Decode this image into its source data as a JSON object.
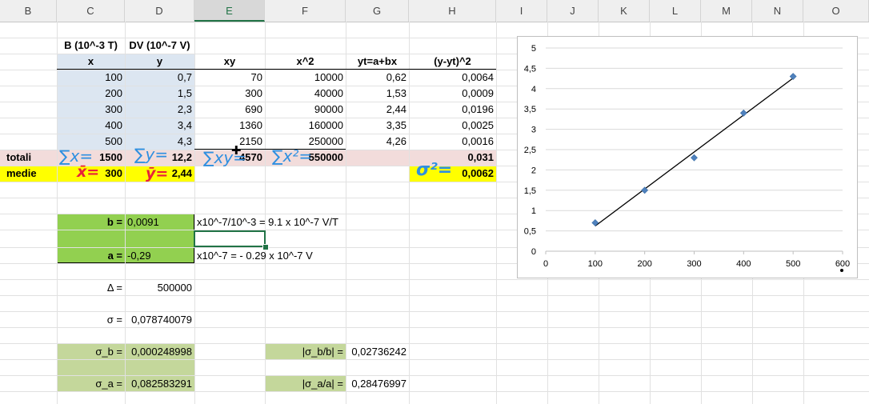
{
  "columns": [
    "B",
    "C",
    "D",
    "E",
    "F",
    "G",
    "H",
    "I",
    "J",
    "K",
    "L",
    "M",
    "N",
    "O"
  ],
  "headers": {
    "B_label": "B (10^-3 T)",
    "DV_label": "DV (10^-7 V)",
    "x": "x",
    "y": "y",
    "xy": "xy",
    "x2": "x^2",
    "yt": "yt=a+bx",
    "res": "(y-yt)^2"
  },
  "rows": [
    {
      "x": "100",
      "y": "0,7",
      "xy": "70",
      "x2": "10000",
      "yt": "0,62",
      "res": "0,0064"
    },
    {
      "x": "200",
      "y": "1,5",
      "xy": "300",
      "x2": "40000",
      "yt": "1,53",
      "res": "0,0009"
    },
    {
      "x": "300",
      "y": "2,3",
      "xy": "690",
      "x2": "90000",
      "yt": "2,44",
      "res": "0,0196"
    },
    {
      "x": "400",
      "y": "3,4",
      "xy": "1360",
      "x2": "160000",
      "yt": "3,35",
      "res": "0,0025"
    },
    {
      "x": "500",
      "y": "4,3",
      "xy": "2150",
      "x2": "250000",
      "yt": "4,26",
      "res": "0,0016"
    }
  ],
  "totali": {
    "label": "totali",
    "x": "1500",
    "y": "12,2",
    "xy": "4570",
    "x2": "550000",
    "res": "0,031"
  },
  "medie": {
    "label": "medie",
    "x": "300",
    "y": "2,44",
    "res": "0,0062"
  },
  "fit": {
    "b_label": "b =",
    "b_value": "0,0091",
    "b_note": "x10^-7/10^-3 = 9.1 x 10^-7 V/T",
    "a_label": "a =",
    "a_value": "-0,29",
    "a_note": "x10^-7 = - 0.29 x 10^-7 V"
  },
  "stats": {
    "delta_label": "Δ =",
    "delta_value": "500000",
    "sigma_label": "σ =",
    "sigma_value": "0,078740079",
    "sigma_b_label": "σ_b =",
    "sigma_b_value": "0,000248998",
    "sigma_a_label": "σ_a =",
    "sigma_a_value": "0,082583291",
    "rel_b_label": "|σ_b/b| =",
    "rel_b_value": "0,02736242",
    "rel_a_label": "|σ_a/a| =",
    "rel_a_value": "0,28476997"
  },
  "handwriting": {
    "sum_x": "∑x=",
    "sum_y": "∑y=",
    "sum_xy": "∑xy=",
    "sum_x2": "∑x²=",
    "mean_x": "x̄=",
    "mean_y": "ȳ=",
    "sigma2": "σ²="
  },
  "colors": {
    "blue_fill": "#dce6f1",
    "pink_fill": "#f2dcdb",
    "yellow_fill": "#ffff00",
    "green_fill": "#92d050",
    "lightgreen_fill": "#c4d79b",
    "ink_blue": "#2e8fe0",
    "ink_red": "#e8203a",
    "marker": "#4f81bd"
  },
  "chart_data": {
    "type": "scatter",
    "x": [
      100,
      200,
      300,
      400,
      500
    ],
    "y": [
      0.7,
      1.5,
      2.3,
      3.4,
      4.3
    ],
    "trendline": {
      "x": [
        100,
        500
      ],
      "y": [
        0.62,
        4.26
      ]
    },
    "xlim": [
      0,
      600
    ],
    "ylim": [
      0,
      5
    ],
    "xticks": [
      "0",
      "100",
      "200",
      "300",
      "400",
      "500",
      "600"
    ],
    "yticks": [
      "0",
      "0,5",
      "1",
      "1,5",
      "2",
      "2,5",
      "3",
      "3,5",
      "4",
      "4,5",
      "5"
    ],
    "grid": true,
    "title": "",
    "xlabel": "",
    "ylabel": ""
  }
}
